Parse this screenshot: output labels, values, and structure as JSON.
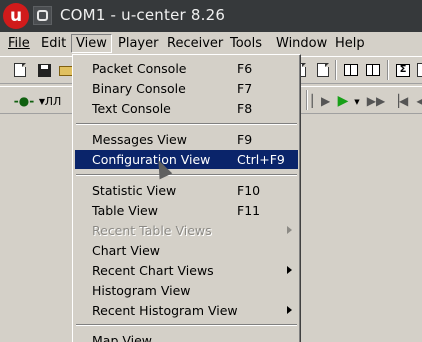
{
  "window": {
    "app_icon_letter": "u",
    "title": "COM1 - u-center 8.26"
  },
  "menubar": {
    "items": [
      {
        "label": "File"
      },
      {
        "label": "Edit"
      },
      {
        "label": "View"
      },
      {
        "label": "Player"
      },
      {
        "label": "Receiver"
      },
      {
        "label": "Tools"
      },
      {
        "label": "Window"
      },
      {
        "label": "Help"
      }
    ],
    "active": "View"
  },
  "view_menu": {
    "items": [
      {
        "label": "Packet Console",
        "shortcut": "F6"
      },
      {
        "label": "Binary Console",
        "shortcut": "F7"
      },
      {
        "label": "Text Console",
        "shortcut": "F8"
      },
      {
        "label": "Messages View",
        "shortcut": "F9"
      },
      {
        "label": "Configuration View",
        "shortcut": "Ctrl+F9"
      },
      {
        "label": "Statistic View",
        "shortcut": "F10"
      },
      {
        "label": "Table View",
        "shortcut": "F11"
      },
      {
        "label": "Recent Table Views",
        "shortcut": ""
      },
      {
        "label": "Chart View",
        "shortcut": ""
      },
      {
        "label": "Recent Chart Views",
        "shortcut": ""
      },
      {
        "label": "Histogram View",
        "shortcut": ""
      },
      {
        "label": "Recent Histogram View",
        "shortcut": ""
      },
      {
        "label": "Map View",
        "shortcut": ""
      }
    ],
    "highlighted": "Configuration View",
    "disabled": [
      "Recent Table Views"
    ]
  },
  "colors": {
    "titlebar_bg": "#36393b",
    "highlight_bg": "#0a246a",
    "app_icon_red": "#d11b1b",
    "play_green": "#18a018"
  }
}
